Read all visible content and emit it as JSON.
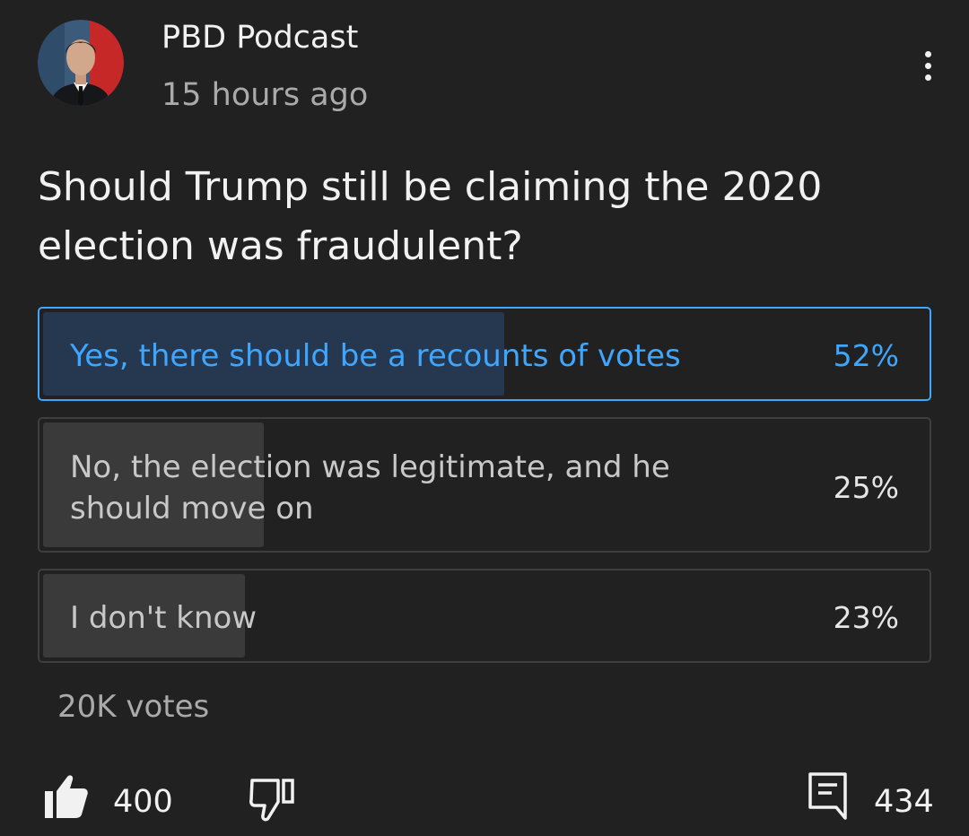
{
  "post": {
    "channel_name": "PBD Podcast",
    "time_ago": "15 hours ago"
  },
  "poll": {
    "question": "Should Trump still be claiming the 2020 election was fraudulent?",
    "options": [
      {
        "label": "Yes, there should be a recounts of votes",
        "percent_label": "52%",
        "percent": 52,
        "selected": true
      },
      {
        "label": "No, the election was legitimate, and he should move on",
        "percent_label": "25%",
        "percent": 25,
        "selected": false
      },
      {
        "label": "I don't know",
        "percent_label": "23%",
        "percent": 23,
        "selected": false
      }
    ],
    "votes": "20K votes"
  },
  "actions": {
    "like_count": "400",
    "comment_count": "434",
    "icons": {
      "like": "thumbs-up-icon",
      "dislike": "thumbs-down-icon",
      "comment": "comment-icon",
      "menu": "more-vert-icon"
    }
  },
  "colors": {
    "background": "#212121",
    "accent": "#3ea6ff",
    "selected_fill": "#263850",
    "option_fill": "#3a3a3a",
    "border": "#3e3e3e",
    "secondary_text": "#aaaaaa"
  }
}
